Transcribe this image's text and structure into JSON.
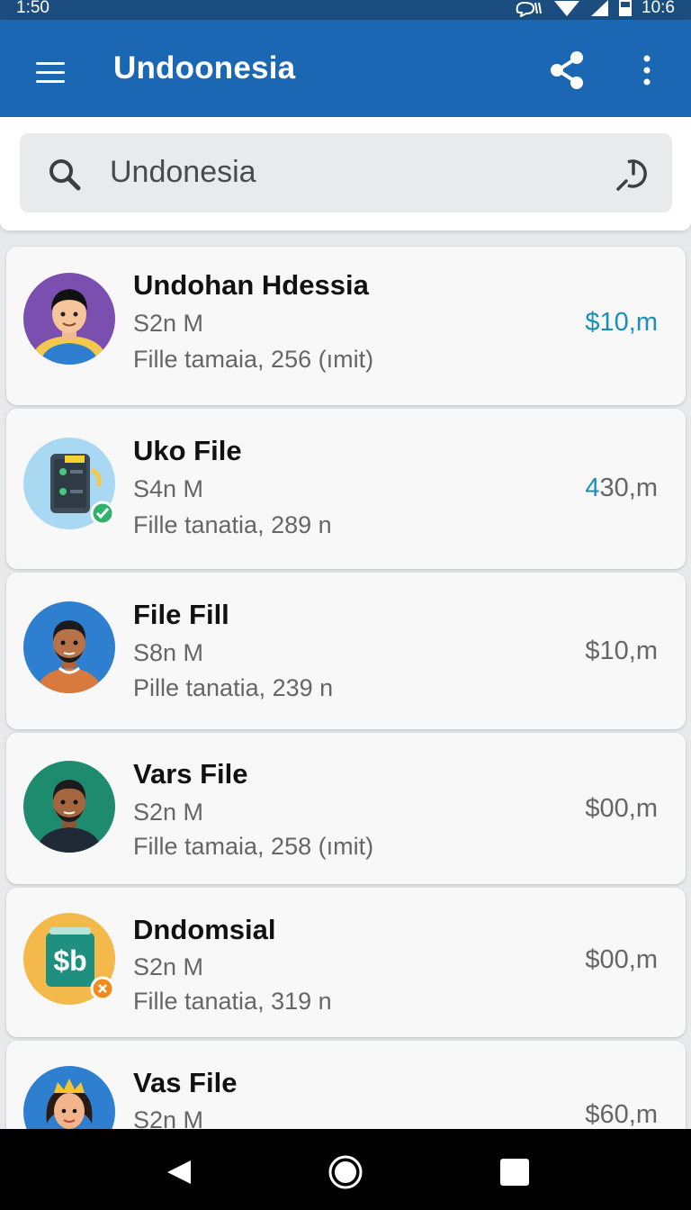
{
  "status_bar": {
    "time_left": "1:50",
    "time_right": "10:6"
  },
  "app_bar": {
    "title": "Undoonesia",
    "menu_icon": "hamburger-menu-icon",
    "share_icon": "share-icon",
    "more_icon": "more-vert-icon"
  },
  "search": {
    "value": "Undonesia",
    "search_icon": "search-icon",
    "voice_icon": "voice-search-icon"
  },
  "items": [
    {
      "title": "Undohan Hdessia",
      "subtitle": "S2n M",
      "description": "Fille tamaia, 256 (ımit)",
      "price": "$10,m",
      "price_color": "#1b8fb8",
      "avatar": "man-avatar-purple"
    },
    {
      "title": "Uko File",
      "subtitle": "S4n M",
      "description": "Fille tanatia, 289 n",
      "price_accent": "4",
      "price": "30,m",
      "price_color": "#1b8fb8",
      "avatar": "device-check-avatar"
    },
    {
      "title": "File Fill",
      "subtitle": "S8n M",
      "description": "Pille tanatia, 239 n",
      "price": "$10,m",
      "price_color": "#666666",
      "avatar": "man-avatar-blue"
    },
    {
      "title": "Vars File",
      "subtitle": "S2n M",
      "description": "Fille tamaia, 258 (ımit)",
      "price": "$00,m",
      "price_color": "#666666",
      "avatar": "man-avatar-green"
    },
    {
      "title": "Dndomsial",
      "subtitle": "S2n M",
      "description": "Fille tanatia, 319 n",
      "price": "$00,m",
      "price_color": "#666666",
      "avatar": "money-app-avatar",
      "avatar_text": "$b"
    },
    {
      "title": "Vas File",
      "subtitle": "S2n M",
      "description": "",
      "price": "$60,m",
      "price_color": "#666666",
      "avatar": "woman-crown-avatar"
    }
  ],
  "nav_bar": {
    "back_icon": "back-icon",
    "home_icon": "home-icon",
    "recent_icon": "recent-apps-icon"
  }
}
